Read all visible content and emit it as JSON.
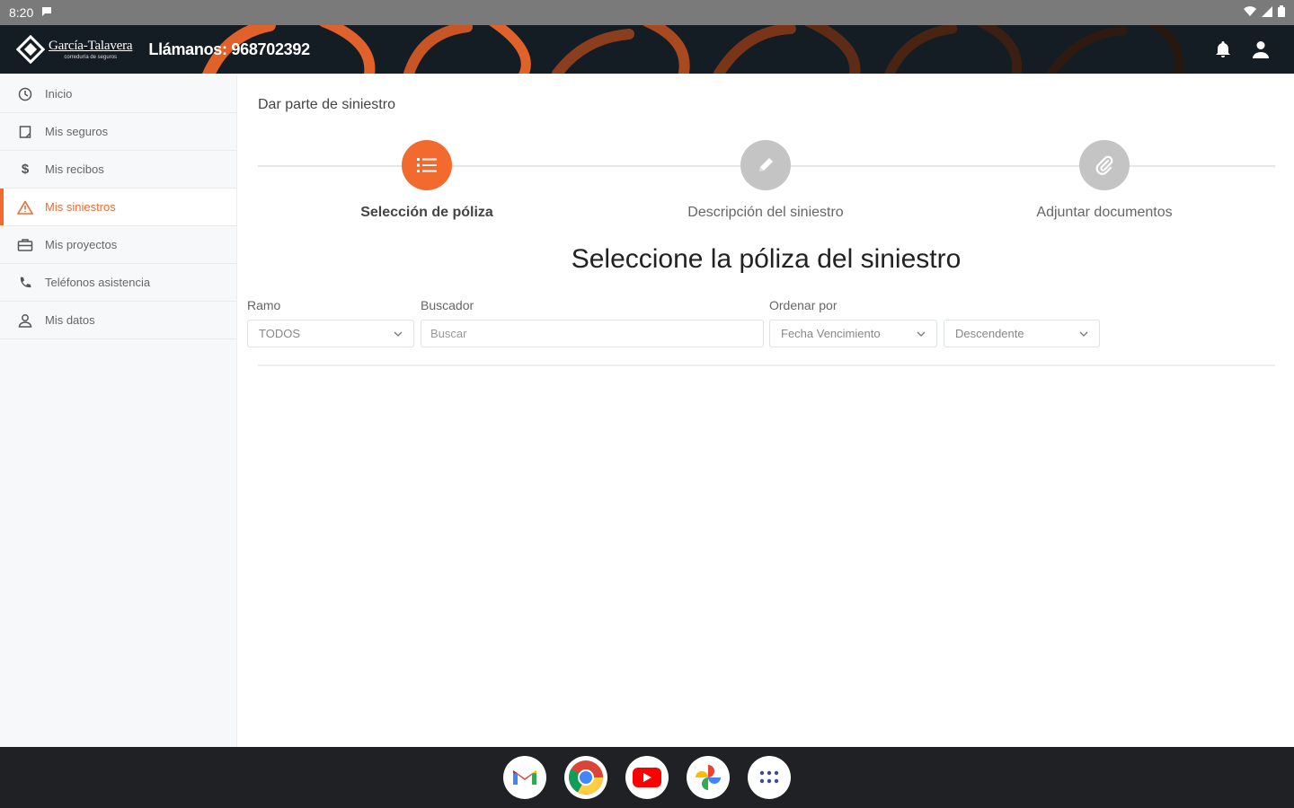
{
  "status_bar": {
    "time": "8:20"
  },
  "header": {
    "logo_name": "García-Talavera",
    "logo_sub": "correduría de seguros",
    "phone": "Llámanos: 968702392",
    "icons": [
      "bell-icon",
      "user-icon"
    ],
    "accent_color": "#f26a2e",
    "background_color": "#141c24"
  },
  "sidebar": {
    "items": [
      {
        "label": "Inicio",
        "icon": "clock-icon"
      },
      {
        "label": "Mis seguros",
        "icon": "document-icon"
      },
      {
        "label": "Mis recibos",
        "icon": "dollar-icon"
      },
      {
        "label": "Mis siniestros",
        "icon": "warning-icon",
        "active": true
      },
      {
        "label": "Mis proyectos",
        "icon": "briefcase-icon"
      },
      {
        "label": "Teléfonos asistencia",
        "icon": "phone-icon"
      },
      {
        "label": "Mis datos",
        "icon": "user-icon"
      }
    ]
  },
  "main": {
    "page_title": "Dar parte de siniestro",
    "steps": [
      {
        "label": "Selección de póliza",
        "icon": "list-icon",
        "active": true
      },
      {
        "label": "Descripción del siniestro",
        "icon": "pencil-icon",
        "active": false
      },
      {
        "label": "Adjuntar documentos",
        "icon": "paperclip-icon",
        "active": false
      }
    ],
    "section_title": "Seleccione la póliza del siniestro",
    "filters": {
      "ramo": {
        "label": "Ramo",
        "value": "TODOS"
      },
      "buscador": {
        "label": "Buscador",
        "placeholder": "Buscar"
      },
      "ordenar": {
        "label": "Ordenar por",
        "value": "Fecha Vencimiento"
      },
      "direction": {
        "value": "Descendente"
      }
    }
  },
  "taskbar": {
    "apps": [
      "gmail-icon",
      "chrome-icon",
      "youtube-icon",
      "photos-icon",
      "app-drawer-icon"
    ]
  }
}
